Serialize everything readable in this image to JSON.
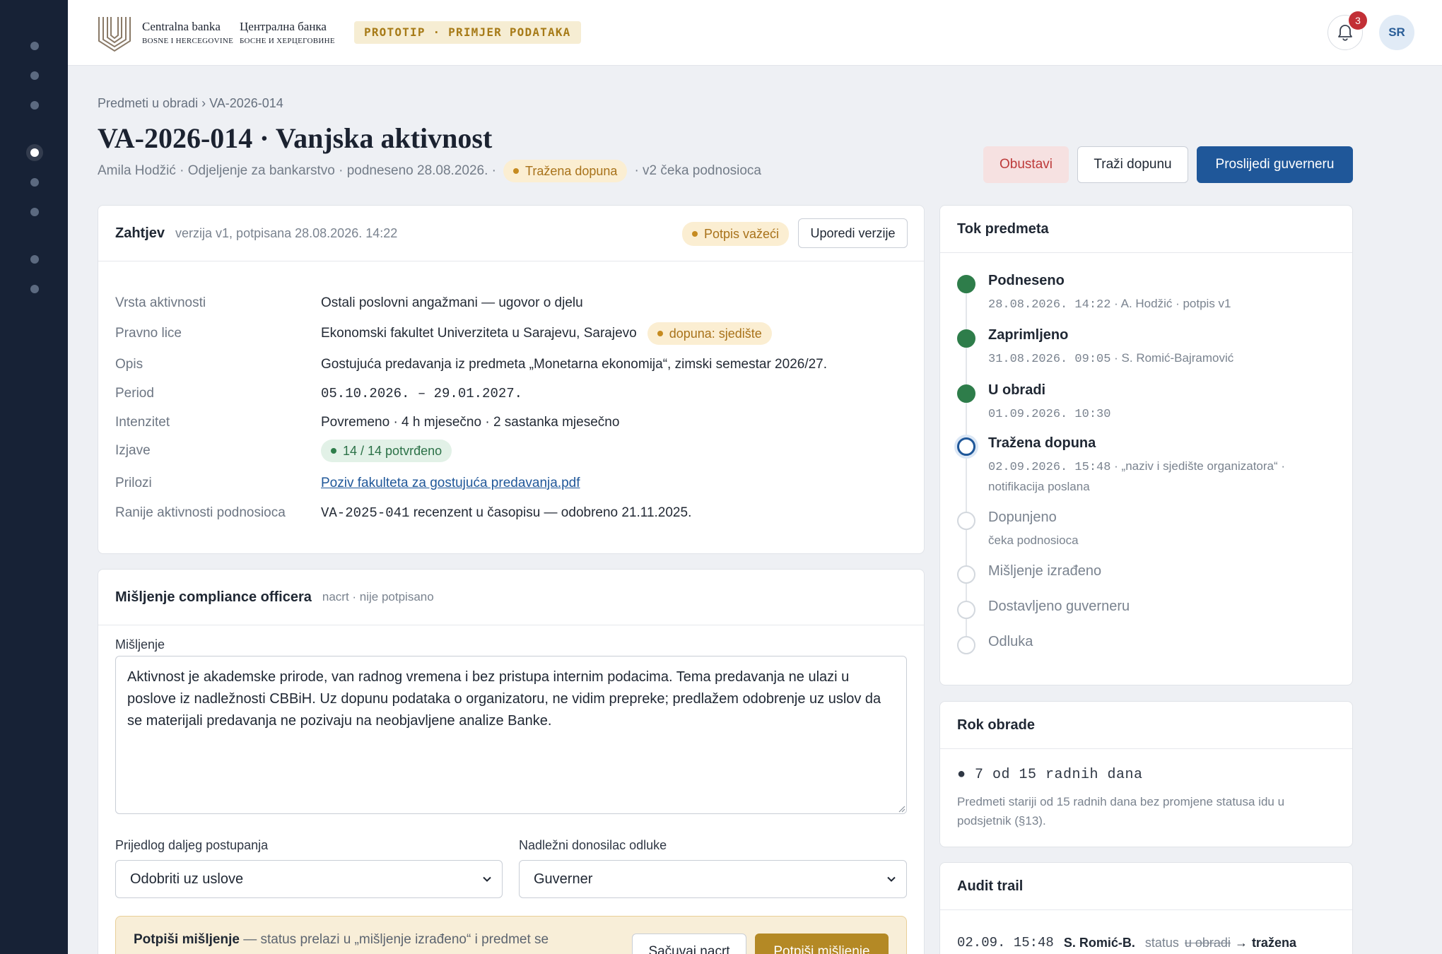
{
  "topbar": {
    "bank_name_latin": "Centralna banka",
    "bank_sub_latin": "BOSNE I HERCEGOVINE",
    "bank_name_cyrillic": "Централна банка",
    "bank_sub_cyrillic": "БОСНЕ И ХЕРЦЕГОВИНЕ",
    "prototype_badge": "PROTOTIP · PRIMJER PODATAKA",
    "notification_count": "3",
    "user_initials": "SR",
    "icons": [
      "bank-logo",
      "bell-icon"
    ]
  },
  "sidebar": {
    "active_index": 3,
    "items": [
      "nav-1",
      "nav-2",
      "nav-3",
      "nav-4",
      "nav-5",
      "nav-6",
      "nav-7",
      "nav-8"
    ]
  },
  "header": {
    "breadcrumb": "Predmeti u obradi › VA-2026-014",
    "title": "VA-2026-014 · Vanjska aktivnost",
    "meta_before": "Amila Hodžić · Odjeljenje za bankarstvo · podneseno 28.08.2026. ·",
    "status_pill": "Tražena dopuna",
    "meta_after": "· v2 čeka podnosioca",
    "btn_stop": "Obustavi",
    "btn_request": "Traži dopunu",
    "btn_forward": "Proslijedi guverneru"
  },
  "request": {
    "title": "Zahtjev",
    "subtitle": "verzija v1, potpisana 28.08.2026. 14:22",
    "signature_pill": "Potpis važeći",
    "compare_button": "Uporedi verzije",
    "fields": {
      "activity_type": {
        "label": "Vrsta aktivnosti",
        "value": "Ostali poslovni angažmani — ugovor o djelu"
      },
      "legal_entity": {
        "label": "Pravno lice",
        "value": "Ekonomski fakultet Univerziteta u Sarajevu, Sarajevo",
        "pill": "dopuna: sjedište"
      },
      "description": {
        "label": "Opis",
        "value": "Gostujuća predavanja iz predmeta „Monetarna ekonomija“, zimski semestar 2026/27."
      },
      "period": {
        "label": "Period",
        "value": "05.10.2026. – 29.01.2027."
      },
      "intensity": {
        "label": "Intenzitet",
        "value": "Povremeno · 4 h mjesečno · 2 sastanka mjesečno"
      },
      "statements": {
        "label": "Izjave",
        "pill": "14 / 14 potvrđeno"
      },
      "attachments": {
        "label": "Prilozi",
        "link": "Poziv fakulteta za gostujuća predavanja.pdf"
      },
      "previous": {
        "label": "Ranije aktivnosti podnosioca",
        "code": "VA-2025-041",
        "text": " recenzent u časopisu — odobreno 21.11.2025."
      }
    }
  },
  "opinion": {
    "title": "Mišljenje compliance officera",
    "subtitle": "nacrt · nije potpisano",
    "field_label": "Mišljenje",
    "text": "Aktivnost je akademske prirode, van radnog vremena i bez pristupa internim podacima. Tema predavanja ne ulazi u poslove iz nadležnosti CBBiH. Uz dopunu podataka o organizatoru, ne vidim prepreke; predlažem odobrenje uz uslov da se materijali predavanja ne pozivaju na neobjavljene analize Banke.",
    "proposal_label": "Prijedlog daljeg postupanja",
    "proposal_value": "Odobriti uz uslove",
    "decision_maker_label": "Nadležni donosilac odluke",
    "decision_maker_value": "Guverner",
    "sign_bold": "Potpiši mišljenje",
    "sign_text": " — status prelazi u „mišljenje izrađeno“ i predmet se",
    "save_button": "Sačuvaj nacrt",
    "sign_button": "Potpiši mišljenje"
  },
  "flow": {
    "title": "Tok predmeta",
    "steps": [
      {
        "title": "Podneseno",
        "date": "28.08.2026. 14:22",
        "note": " · A. Hodžić · potpis v1",
        "state": "done"
      },
      {
        "title": "Zaprimljeno",
        "date": "31.08.2026. 09:05",
        "note": " · S. Romić-Bajramović",
        "state": "done"
      },
      {
        "title": "U obradi",
        "date": "01.09.2026. 10:30",
        "note": "",
        "state": "done"
      },
      {
        "title": "Tražena dopuna",
        "date": "02.09.2026. 15:48",
        "note": " · „naziv i sjedište organizatora“ · notifikacija poslana",
        "state": "current"
      },
      {
        "title": "Dopunjeno",
        "date": "",
        "note": "čeka podnosioca",
        "state": "pending"
      },
      {
        "title": "Mišljenje izrađeno",
        "date": "",
        "note": "",
        "state": "pending"
      },
      {
        "title": "Dostavljeno guverneru",
        "date": "",
        "note": "",
        "state": "pending"
      },
      {
        "title": "Odluka",
        "date": "",
        "note": "",
        "state": "pending"
      }
    ]
  },
  "deadline": {
    "title": "Rok obrade",
    "counter": "● 7 od 15 radnih dana",
    "note": "Predmeti stariji od 15 radnih dana bez promjene statusa idu u podsjetnik (§13)."
  },
  "audit": {
    "title": "Audit trail",
    "entries": [
      {
        "time": "02.09. 15:48",
        "user": "S. Romić-B.",
        "label": "status",
        "from": "u obradi",
        "arrow": "→",
        "to": "tražena"
      }
    ]
  },
  "colors": {
    "sidebar": "#172236",
    "primary": "#1f5799",
    "done_green": "#2e7d4a",
    "warning_amber": "#c68b20",
    "danger": "#bd3a3a",
    "gold": "#b48925"
  }
}
